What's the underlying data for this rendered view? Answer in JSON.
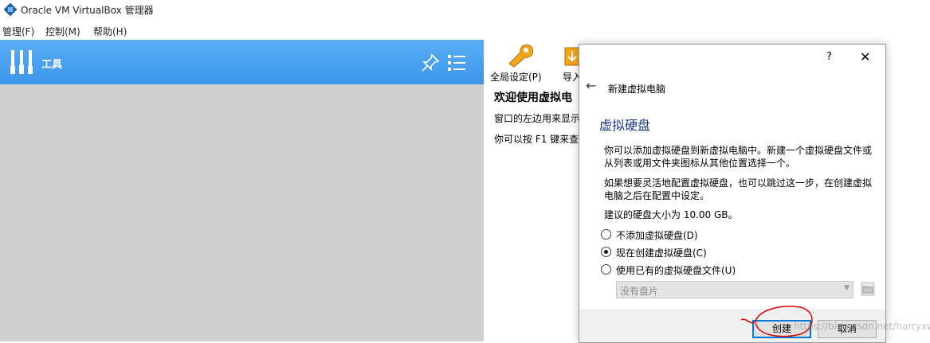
{
  "window": {
    "title": "Oracle VM VirtualBox 管理器"
  },
  "menu": [
    "管理(F)",
    "控制(M)",
    "帮助(H)"
  ],
  "tools": {
    "label": "工具"
  },
  "toolbar": {
    "global_settings": "全局设定(P)",
    "import": "导入"
  },
  "welcome": {
    "title": "欢迎使用虚拟电",
    "line1": "窗口的左边用来显示",
    "line2": "你可以按 F1 键来查"
  },
  "dialog": {
    "help": "?",
    "close": "✕",
    "wizard_title": "新建虚拟电脑",
    "page_title": "虚拟硬盘",
    "para1": "你可以添加虚拟硬盘到新虚拟电脑中。新建一个虚拟硬盘文件或从列表或用文件夹图标从其他位置选择一个。",
    "para2": "如果想要灵活地配置虚拟硬盘，也可以跳过这一步，在创建虚拟电脑之后在配置中设定。",
    "recommended": "建议的硬盘大小为 10.00 GB。",
    "options": [
      {
        "label": "不添加虚拟硬盘(D)",
        "checked": false
      },
      {
        "label": "现在创建虚拟硬盘(C)",
        "checked": true
      },
      {
        "label": "使用已有的虚拟硬盘文件(U)",
        "checked": false
      }
    ],
    "disk_select": "没有盘片",
    "create_button": "创建",
    "cancel_button": "取消"
  },
  "watermark": "https://blog.csdn.net/harryxworks",
  "colors": {
    "accent": "#3c95ea",
    "left_pane_bg": "#cfcfcf",
    "annotation": "#e00000"
  }
}
